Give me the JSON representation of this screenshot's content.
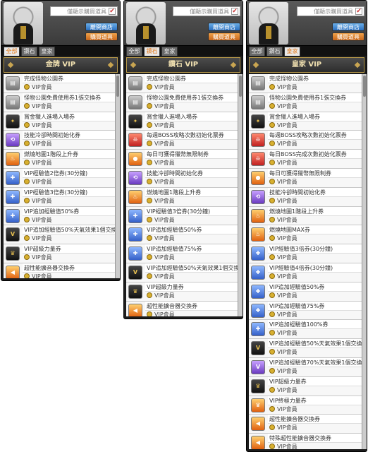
{
  "common": {
    "checkbox_label": "僅顯示購買道具",
    "btn_shop": "離開商店",
    "btn_buy": "購買道具",
    "tabs": [
      "全部",
      "鑽石",
      "皇家"
    ],
    "tag": "VIP會員"
  },
  "panels": [
    {
      "title": "金牌 VIP",
      "active_tab": 0,
      "items": [
        {
          "name": "完成怪物公園券",
          "icon": "ticket-icon",
          "color": "gray"
        },
        {
          "name": "怪物公園免費使用券1張交換券",
          "icon": "ticket-icon",
          "color": "gray"
        },
        {
          "name": "賞金獵人進場入場券",
          "icon": "wings-icon",
          "color": "dark"
        },
        {
          "name": "技能冷卻時間初始化券",
          "icon": "skill-icon",
          "color": "purple"
        },
        {
          "name": "燃燒地圖1階段上升券",
          "icon": "fire-icon",
          "color": "orange"
        },
        {
          "name": "VIP經驗值2倍券(30分鐘)",
          "icon": "exp-icon",
          "color": "blue"
        },
        {
          "name": "VIP經驗值3倍券(30分鐘)",
          "icon": "exp-icon",
          "color": "blue"
        },
        {
          "name": "VIP追加經驗值50%券",
          "icon": "exp-icon",
          "color": "blue"
        },
        {
          "name": "VIP追加經驗值50%天氣效果1個交換券",
          "icon": "vip-icon",
          "color": "dark"
        },
        {
          "name": "VIP超級力量券",
          "icon": "crown-icon",
          "color": "dark"
        },
        {
          "name": "超性能擴音器交換券",
          "icon": "megaphone-icon",
          "color": "orange"
        }
      ]
    },
    {
      "title": "鑽石 VIP",
      "active_tab": 1,
      "items": [
        {
          "name": "完成怪物公園券",
          "icon": "ticket-icon",
          "color": "gray"
        },
        {
          "name": "怪物公園免費使用券1張交換券",
          "icon": "ticket-icon",
          "color": "gray"
        },
        {
          "name": "賞金獵人進場入場券",
          "icon": "wings-icon",
          "color": "dark"
        },
        {
          "name": "每週BOSS攻略次數初始化票券",
          "icon": "boss-icon",
          "color": "red"
        },
        {
          "name": "每日可獲得獵幣無限制券",
          "icon": "coin-icon",
          "color": "orange"
        },
        {
          "name": "技能冷卻時間初始化券",
          "icon": "skill-icon",
          "color": "purple"
        },
        {
          "name": "燃燒地圖1階段上升券",
          "icon": "fire-icon",
          "color": "orange"
        },
        {
          "name": "VIP經驗值3倍券(30分鐘)",
          "icon": "exp-icon",
          "color": "blue"
        },
        {
          "name": "VIP追加經驗值50%券",
          "icon": "exp-icon",
          "color": "blue"
        },
        {
          "name": "VIP追加經驗值75%券",
          "icon": "exp-icon",
          "color": "blue"
        },
        {
          "name": "VIP追加經驗值50%天氣效果1個交換券",
          "icon": "vip-icon",
          "color": "dark"
        },
        {
          "name": "VIP超級力量券",
          "icon": "crown-icon",
          "color": "dark"
        },
        {
          "name": "超性能擴音器交換券",
          "icon": "megaphone-icon",
          "color": "orange"
        }
      ]
    },
    {
      "title": "皇家 VIP",
      "active_tab": 2,
      "items": [
        {
          "name": "完成怪物公園券",
          "icon": "ticket-icon",
          "color": "gray"
        },
        {
          "name": "怪物公園免費使用券1張交換券",
          "icon": "ticket-icon",
          "color": "gray"
        },
        {
          "name": "賞金獵人進場入場券",
          "icon": "wings-icon",
          "color": "dark"
        },
        {
          "name": "每週BOSS攻略次數初始化票券",
          "icon": "boss-icon",
          "color": "red"
        },
        {
          "name": "每日BOSS完成次數初始化票券",
          "icon": "boss-icon",
          "color": "red"
        },
        {
          "name": "每日可獲得獵幣無限制券",
          "icon": "coin-icon",
          "color": "orange"
        },
        {
          "name": "技能冷卻時間初始化券",
          "icon": "skill-icon",
          "color": "purple"
        },
        {
          "name": "燃燒地圖1階段上升券",
          "icon": "fire-icon",
          "color": "orange"
        },
        {
          "name": "燃燒地圖MAX券",
          "icon": "fire-icon",
          "color": "orange"
        },
        {
          "name": "VIP經驗值3倍券(30分鐘)",
          "icon": "exp-icon",
          "color": "blue"
        },
        {
          "name": "VIP經驗值4倍券(30分鐘)",
          "icon": "exp-icon",
          "color": "blue"
        },
        {
          "name": "VIP追加經驗值50%券",
          "icon": "exp-icon",
          "color": "blue"
        },
        {
          "name": "VIP追加經驗值75%券",
          "icon": "exp-icon",
          "color": "blue"
        },
        {
          "name": "VIP追加經驗值100%券",
          "icon": "exp-icon",
          "color": "blue"
        },
        {
          "name": "VIP追加經驗值50%天氣效果1個交換券",
          "icon": "vip-icon",
          "color": "dark"
        },
        {
          "name": "VIP追加經驗值70%天氣效果1個交換券",
          "icon": "vip-icon",
          "color": "purple"
        },
        {
          "name": "VIP超級力量券",
          "icon": "crown-icon",
          "color": "dark"
        },
        {
          "name": "VIP終極力量券",
          "icon": "crown-icon",
          "color": "orange"
        },
        {
          "name": "超性能擴音器交換券",
          "icon": "megaphone-icon",
          "color": "orange"
        },
        {
          "name": "特殊超性能擴音器交換券",
          "icon": "megaphone-icon",
          "color": "orange"
        }
      ]
    }
  ]
}
